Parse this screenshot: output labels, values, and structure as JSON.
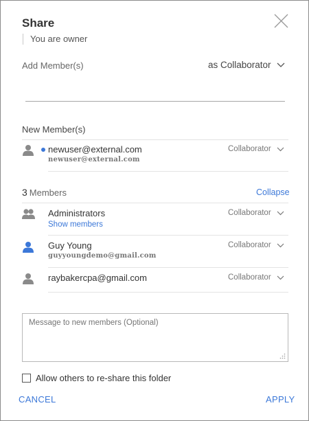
{
  "dialog": {
    "title": "Share",
    "owner_text": "You are owner"
  },
  "add": {
    "label": "Add Member(s)",
    "role": "as Collaborator",
    "input_value": ""
  },
  "new_members": {
    "label": "New Member(s)",
    "items": [
      {
        "name": "newuser@external.com",
        "sub": "newuser@external.com",
        "role": "Collaborator"
      }
    ]
  },
  "members": {
    "count": "3",
    "label": "Members",
    "collapse_label": "Collapse",
    "items": [
      {
        "name": "Administrators",
        "link": "Show members",
        "role": "Collaborator",
        "icon": "group-icon"
      },
      {
        "name": "Guy Young",
        "sub": "guyyoungdemo@gmail.com",
        "role": "Collaborator",
        "icon": "user-icon"
      },
      {
        "name": "raybakercpa@gmail.com",
        "role": "Collaborator",
        "icon": "user-icon"
      }
    ]
  },
  "message": {
    "placeholder": "Message to new members (Optional)"
  },
  "reshare": {
    "label": "Allow others to re-share this folder",
    "checked": false
  },
  "actions": {
    "cancel": "CANCEL",
    "apply": "APPLY"
  },
  "colors": {
    "accent": "#3c78d8",
    "icon_gray": "#888888",
    "icon_blue": "#3c78d8"
  }
}
